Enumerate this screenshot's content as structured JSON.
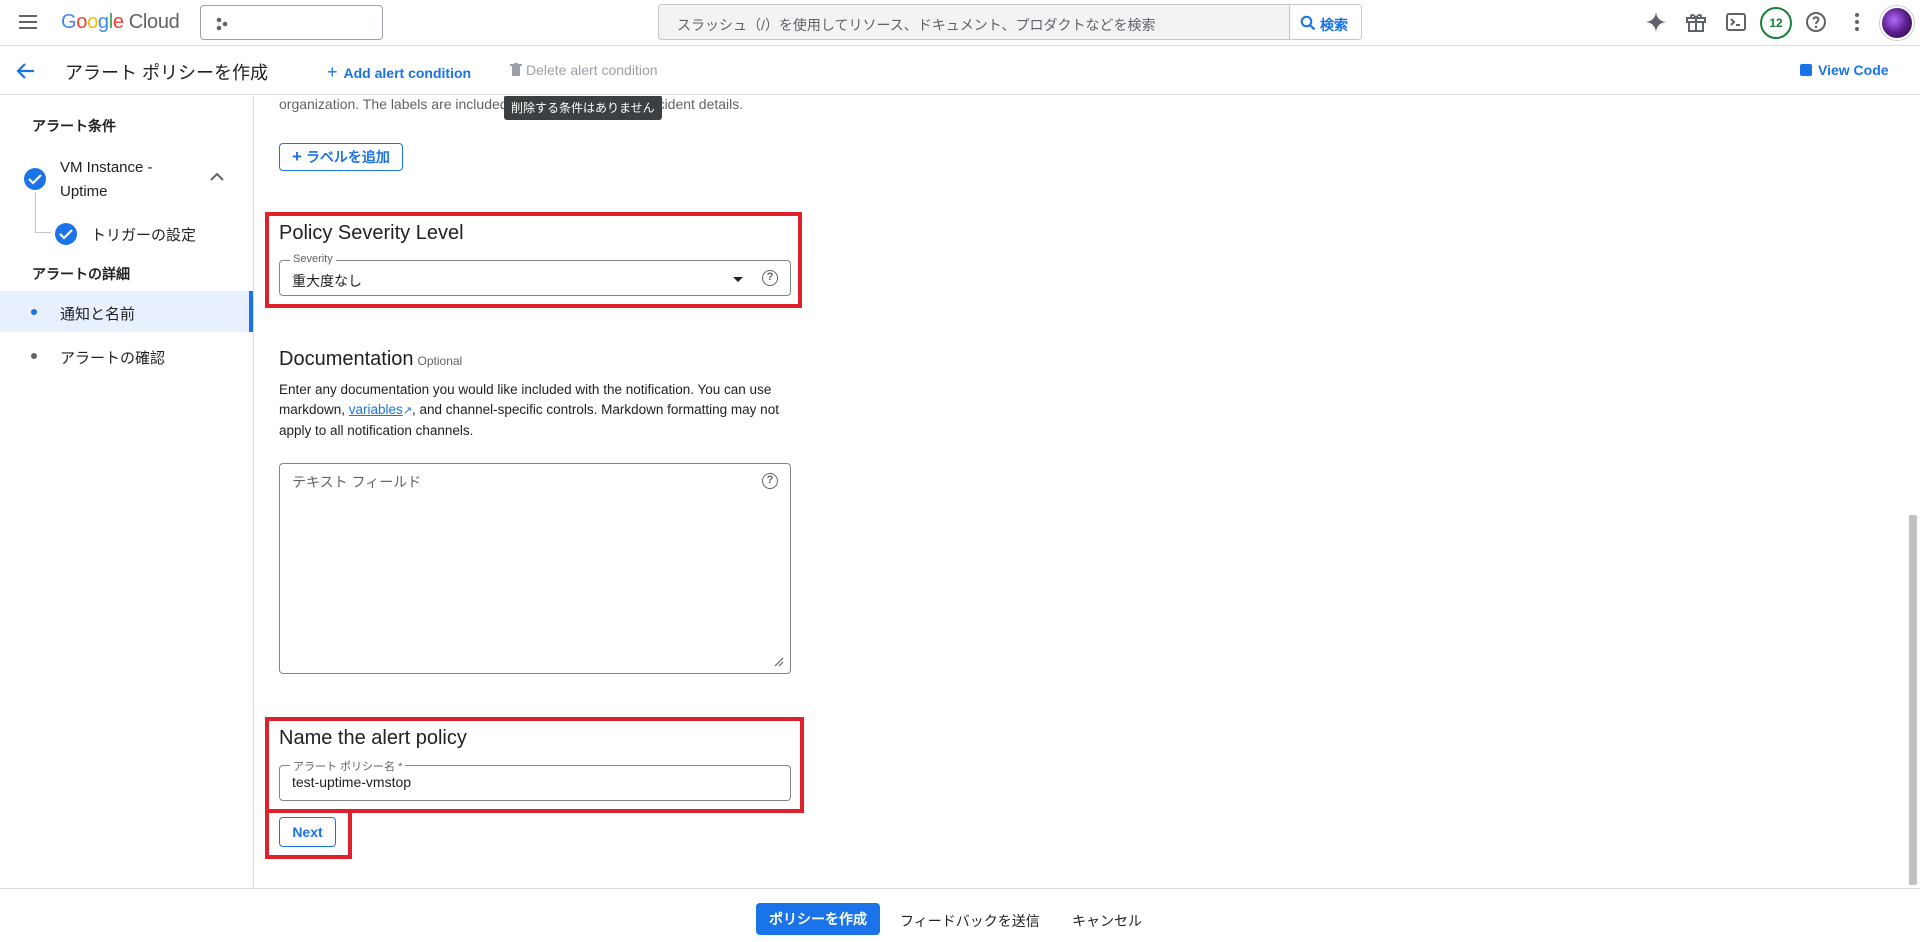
{
  "topbar": {
    "logo_google": "Google",
    "logo_cloud": "Cloud",
    "search_placeholder": "スラッシュ（/）を使用してリソース、ドキュメント、プロダクトなどを検索",
    "search_button": "検索",
    "notification_count": "12",
    "icons": [
      "menu-icon",
      "project-dots-icon",
      "search-icon",
      "gemini-spark-icon",
      "gift-icon",
      "terminal-icon",
      "help-icon",
      "more-vert-icon"
    ]
  },
  "subbar": {
    "title": "アラート ポリシーを作成",
    "add_condition": "Add alert condition",
    "delete_condition": "Delete alert condition",
    "view_code": "View Code"
  },
  "sidebar": {
    "conditions_header": "アラート条件",
    "condition_name_line1": "VM Instance -",
    "condition_name_line2": "Uptime",
    "trigger_settings": "トリガーの設定",
    "details_header": "アラートの詳細",
    "items": [
      {
        "label": "通知と名前",
        "active": true
      },
      {
        "label": "アラートの確認",
        "active": false
      }
    ]
  },
  "main": {
    "labels_help_text_start": "organization. The labels are included",
    "labels_help_text_end": "cident details.",
    "tooltip": "削除する条件はありません",
    "add_label_button": "ラベルを追加",
    "severity_section_title": "Policy Severity Level",
    "severity_label": "Severity",
    "severity_value": "重大度なし",
    "doc_title": "Documentation",
    "doc_optional": "Optional",
    "doc_text_1": "Enter any documentation you would like included with the notification. You can use markdown, ",
    "doc_link": "variables",
    "doc_text_2": ", and channel-specific controls. Markdown formatting may not apply to all notification channels.",
    "doc_placeholder": "テキスト フィールド",
    "name_section_title": "Name the alert policy",
    "name_label": "アラート ポリシー名 *",
    "name_value": "test-uptime-vmstop",
    "next_button": "Next"
  },
  "footer": {
    "create_button": "ポリシーを作成",
    "feedback_button": "フィードバックを送信",
    "cancel_button": "キャンセル"
  }
}
